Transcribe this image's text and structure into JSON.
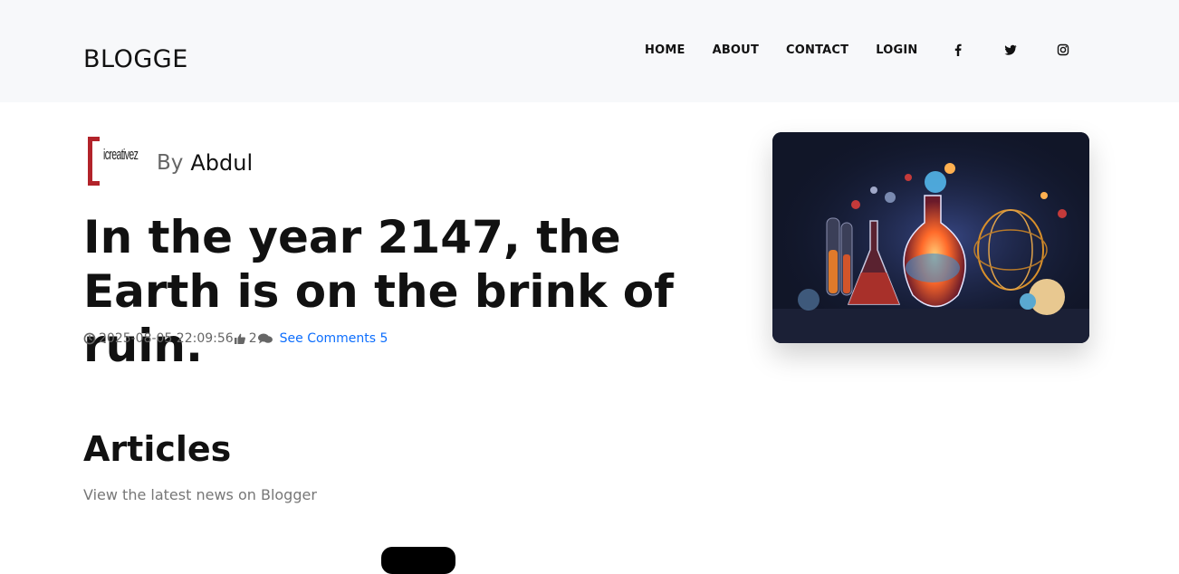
{
  "header": {
    "brand": "BLOGGE",
    "nav": [
      "HOME",
      "ABOUT",
      "CONTACT",
      "LOGIN"
    ],
    "social_icons": [
      "facebook-icon",
      "twitter-icon",
      "instagram-icon"
    ]
  },
  "post": {
    "logo_text": "icreativez",
    "by_label": "By",
    "author": "Abdul",
    "title": "In the year 2147, the Earth is on the brink of ruin.",
    "date": "2025-08-05 22:09:56",
    "likes": "2",
    "comments_link": "See Comments 5"
  },
  "articles": {
    "title": "Articles",
    "subtitle": "View the latest news on Blogger"
  },
  "colors": {
    "header_bg": "#f7f8fa",
    "link": "#0d6efd",
    "logo_red": "#b2232a"
  }
}
